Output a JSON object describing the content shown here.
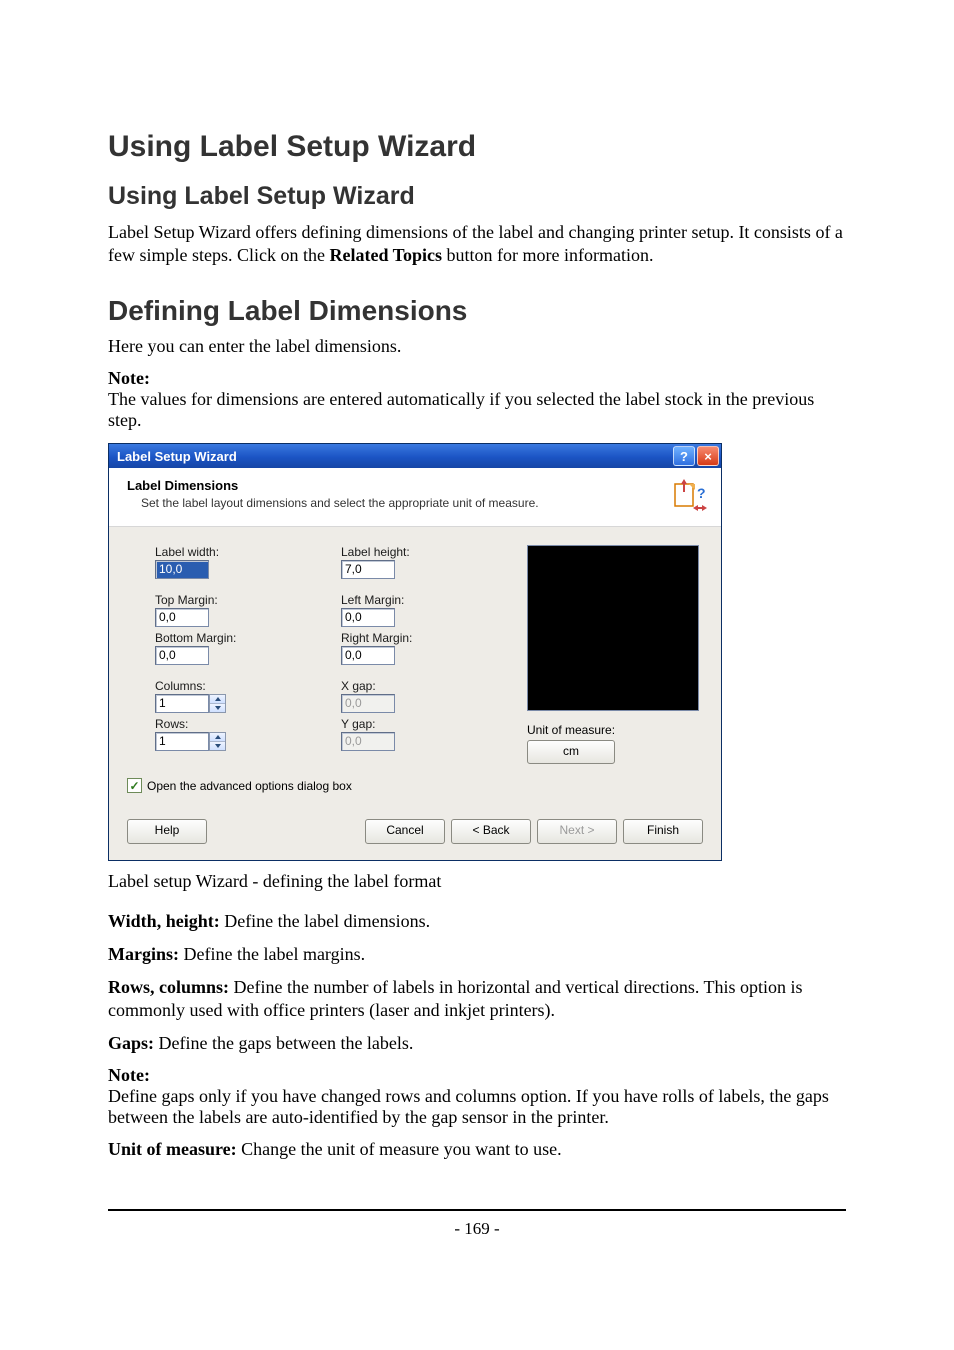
{
  "title": "Using Label Setup Wizard",
  "subtitle": "Using Label Setup Wizard",
  "intro_pre": "Label Setup Wizard offers defining dimensions of the label and changing printer setup. It consists of a few simple steps. Click on the ",
  "intro_bold": "Related Topics",
  "intro_post": " button for more information.",
  "section2_title": "Defining Label Dimensions",
  "section2_intro": "Here you can enter the label dimensions.",
  "note1_label": "Note:",
  "note1_text": " The values for dimensions are entered automatically if you selected the label stock in the previous step.",
  "dialog": {
    "title": "Label Setup Wizard",
    "header_title": "Label Dimensions",
    "header_sub": "Set the label layout dimensions and select the appropriate unit of measure.",
    "labels": {
      "label_width": "Label width:",
      "label_height": "Label height:",
      "top_margin": "Top Margin:",
      "left_margin": "Left Margin:",
      "bottom_margin": "Bottom Margin:",
      "right_margin": "Right Margin:",
      "columns": "Columns:",
      "rows": "Rows:",
      "x_gap": "X gap:",
      "y_gap": "Y gap:",
      "uom": "Unit of measure:"
    },
    "values": {
      "label_width": "10,0",
      "label_height": "7,0",
      "top_margin": "0,0",
      "left_margin": "0,0",
      "bottom_margin": "0,0",
      "right_margin": "0,0",
      "columns": "1",
      "rows": "1",
      "x_gap": "0,0",
      "y_gap": "0,0",
      "uom": "cm"
    },
    "checkbox": "Open the advanced options dialog box",
    "buttons": {
      "help": "Help",
      "cancel": "Cancel",
      "back": "< Back",
      "next": "Next >",
      "finish": "Finish"
    }
  },
  "caption": "Label setup Wizard - defining the label format",
  "defs": {
    "wh_b": "Width, height:",
    "wh_t": " Define the label dimensions.",
    "m_b": "Margins:",
    "m_t": " Define the label margins.",
    "rc_b": "Rows, columns:",
    "rc_t": " Define the number of labels in horizontal and vertical directions. This option is commonly used with office printers (laser and inkjet printers).",
    "g_b": "Gaps:",
    "g_t": " Define the gaps between the labels."
  },
  "note2_label": "Note:",
  "note2_text": " Define gaps only if you have changed rows and columns option. If you have rolls of labels, the gaps between the labels are auto-identified by the gap sensor in the printer.",
  "uom_def_b": "Unit of measure:",
  "uom_def_t": " Change the unit of measure you want to use.",
  "page_number": "- 169 -"
}
